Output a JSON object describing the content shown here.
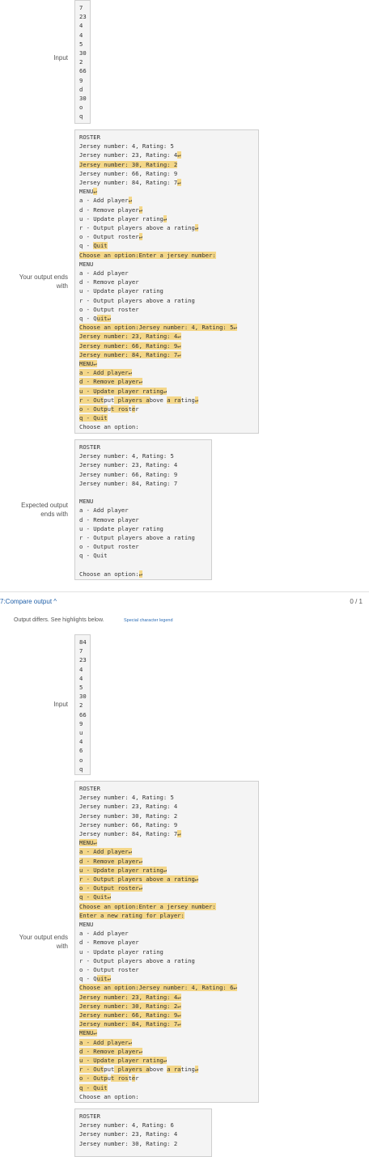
{
  "labels": {
    "input": "Input",
    "your_output": "Your output ends\nwith",
    "expected_output": "Expected output\nends with"
  },
  "test7": {
    "title": "7:Compare output ^",
    "score": "0 / 1",
    "message": "Output differs. See highlights below.",
    "legend_link": "Special character legend"
  },
  "test6": {
    "input": [
      "7",
      "23",
      "4",
      "4",
      "5",
      "30",
      "2",
      "66",
      "9",
      "d",
      "30",
      "o",
      "q"
    ],
    "your_output": [
      "ROSTER",
      "Jersey number: 4, Rating: 5",
      "Jersey number: 23, Rating: 4↵",
      "Jersey number: 30, Rating: 2",
      "Jersey number: 66, Rating: 9",
      "Jersey number: 84, Rating: 7↵",
      "MENU↵",
      "a - Add player↵",
      "d - Remove player↵",
      "u - Update player rating↵",
      "r - Output players above a rating↵",
      "o - Output roster↵",
      "q - Quit",
      "Choose an option:Enter a jersey number:",
      "MENU",
      "a - Add player",
      "d - Remove player",
      "u - Update player rating",
      "r - Output players above a rating",
      "o - Output roster",
      "q - Quit↵",
      "Choose an option:Jersey number: 4, Rating: 5↵",
      "Jersey number: 23, Rating: 4↵",
      "Jersey number: 66, Rating: 9↵",
      "Jersey number: 84, Rating: 7↵",
      "MENU↵",
      "a - Add player↵",
      "d - Remove player↵",
      "u - Update player rating↵",
      "r - Output players above a rating↵",
      "o - Output roster",
      "q - Quit",
      "Choose an option:"
    ],
    "expected_output": [
      "ROSTER",
      "Jersey number: 4, Rating: 5",
      "Jersey number: 23, Rating: 4",
      "Jersey number: 66, Rating: 9",
      "Jersey number: 84, Rating: 7",
      "",
      "MENU",
      "a - Add player",
      "d - Remove player",
      "u - Update player rating",
      "r - Output players above a rating",
      "o - Output roster",
      "q - Quit",
      "",
      "Choose an option:↵"
    ]
  },
  "test7_io": {
    "input": [
      "84",
      "7",
      "23",
      "4",
      "4",
      "5",
      "30",
      "2",
      "66",
      "9",
      "u",
      "4",
      "6",
      "o",
      "q"
    ],
    "your_output": [
      "ROSTER",
      "Jersey number: 4, Rating: 5",
      "Jersey number: 23, Rating: 4",
      "Jersey number: 30, Rating: 2",
      "Jersey number: 66, Rating: 9",
      "Jersey number: 84, Rating: 7↵",
      "MENU↵",
      "a - Add player↵",
      "d - Remove player↵",
      "u - Update player rating↵",
      "r - Output players above a rating↵",
      "o - Output roster↵",
      "q - Quit↵",
      "Choose an option:Enter a jersey number:",
      "Enter a new rating for player:",
      "MENU",
      "a - Add player",
      "d - Remove player",
      "u - Update player rating",
      "r - Output players above a rating",
      "o - Output roster",
      "q - Quit↵",
      "Choose an option:Jersey number: 4, Rating: 6↵",
      "Jersey number: 23, Rating: 4↵",
      "Jersey number: 30, Rating: 2↵",
      "Jersey number: 66, Rating: 9↵",
      "Jersey number: 84, Rating: 7↵",
      "MENU↵",
      "a - Add player↵",
      "d - Remove player↵",
      "u - Update player rating↵",
      "r - Output players above a rating↵",
      "o - Output roster",
      "q - Quit",
      "Choose an option:"
    ],
    "expected_output": [
      "ROSTER",
      "Jersey number: 4, Rating: 6",
      "Jersey number: 23, Rating: 4",
      "Jersey number: 30, Rating: 2"
    ]
  }
}
